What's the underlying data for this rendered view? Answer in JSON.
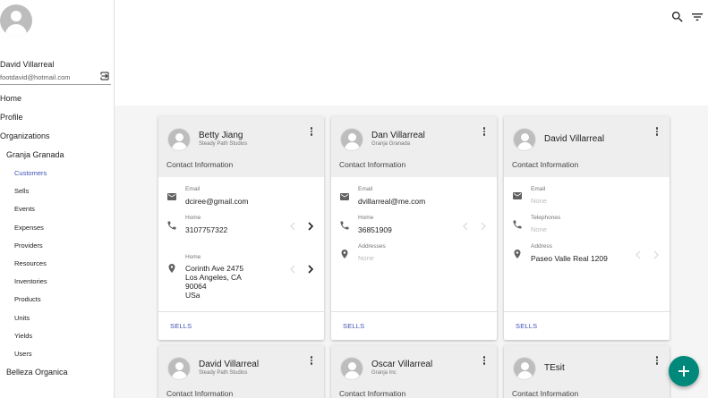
{
  "user": {
    "name": "David Villarreal",
    "email": "footdavid@hotmail.com"
  },
  "nav": {
    "home": "Home",
    "profile": "Profile",
    "organizations": "Organizations",
    "org1": "Granja Granada",
    "sub": [
      "Customers",
      "Sells",
      "Events",
      "Expenses",
      "Providers",
      "Resources",
      "Inventories",
      "Products",
      "Units",
      "Yields",
      "Users"
    ],
    "org2": "Belleza Organica"
  },
  "section_label": "Contact Information",
  "sells_label": "SELLS",
  "cards": [
    {
      "name": "Betty Jiang",
      "company": "Steady Path Studios",
      "email_label": "Email",
      "email": "dciree@gmail.com",
      "phone_label": "Home",
      "phone": "3107757322",
      "address_label": "Home",
      "address": [
        "Corinth Ave 2475",
        "Los Angeles, CA",
        "90064",
        "USa"
      ]
    },
    {
      "name": "Dan Villarreal",
      "company": "Granja Granada",
      "email_label": "Email",
      "email": "dvillarreal@me.com",
      "phone_label": "Home",
      "phone": "36851909",
      "address_label": "Addresses",
      "address_none": "None"
    },
    {
      "name": "David Villarreal",
      "email_label": "Email",
      "email_none": "None",
      "phone_label": "Telephones",
      "phone_none": "None",
      "address_label": "Address",
      "address": "Paseo Valle Real 1209"
    },
    {
      "name": "David Villarreal",
      "company": "Steady Path Studios"
    },
    {
      "name": "Oscar Villarreal",
      "company": "Granja Inc"
    },
    {
      "name": "TEsit"
    }
  ]
}
